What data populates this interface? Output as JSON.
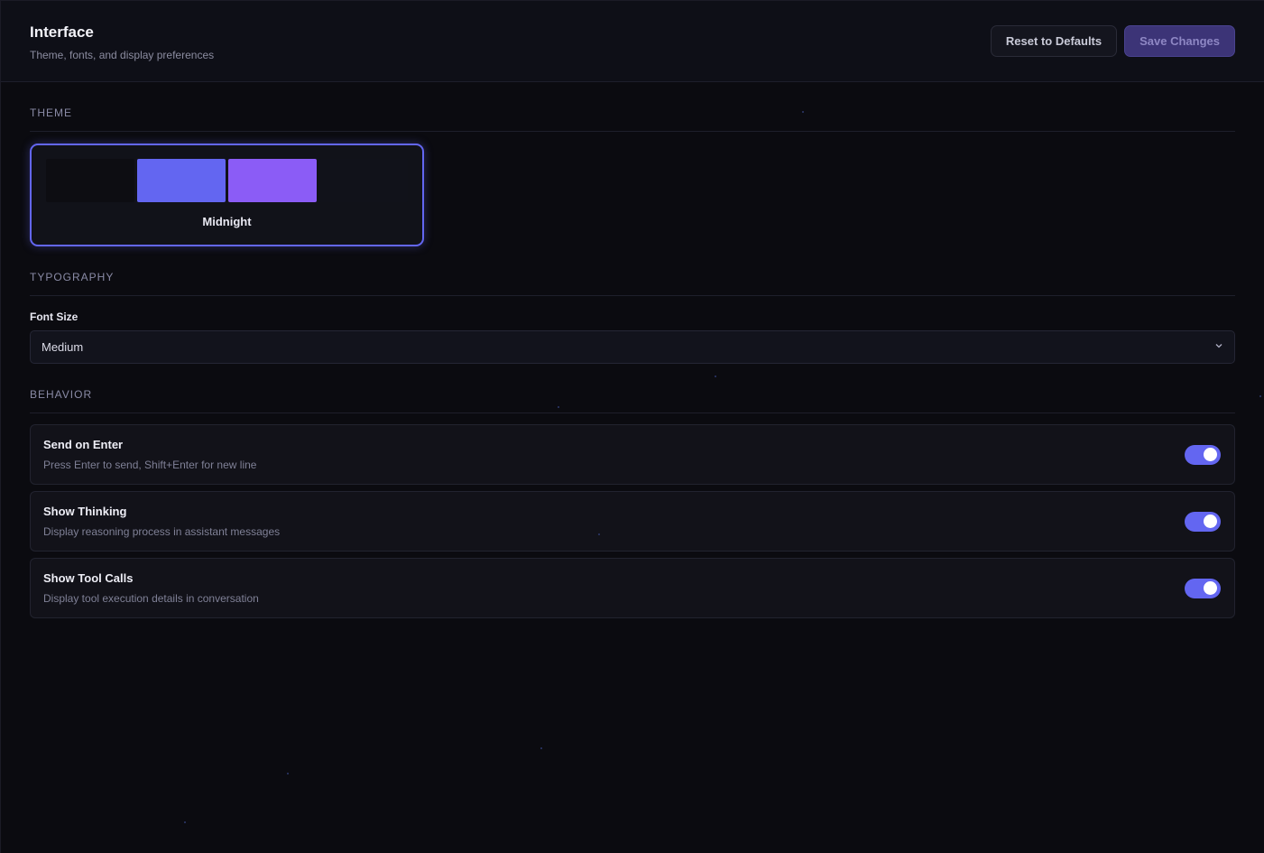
{
  "header": {
    "title": "Interface",
    "subtitle": "Theme, fonts, and display preferences",
    "reset_label": "Reset to Defaults",
    "save_label": "Save Changes"
  },
  "theme": {
    "section_title": "THEME",
    "selected": {
      "name": "Midnight",
      "swatches": [
        "#0d0d12",
        "#6366f1",
        "#8b5cf6",
        "#11121a"
      ]
    }
  },
  "typography": {
    "section_title": "TYPOGRAPHY",
    "font_size_label": "Font Size",
    "font_size_value": "Medium"
  },
  "behavior": {
    "section_title": "BEHAVIOR",
    "toggles": [
      {
        "label": "Send on Enter",
        "description": "Press Enter to send, Shift+Enter for new line",
        "enabled": true
      },
      {
        "label": "Show Thinking",
        "description": "Display reasoning process in assistant messages",
        "enabled": true
      },
      {
        "label": "Show Tool Calls",
        "description": "Display tool execution details in conversation",
        "enabled": true
      }
    ]
  },
  "colors": {
    "accent": "#6366f1",
    "background": "#0b0b10"
  }
}
